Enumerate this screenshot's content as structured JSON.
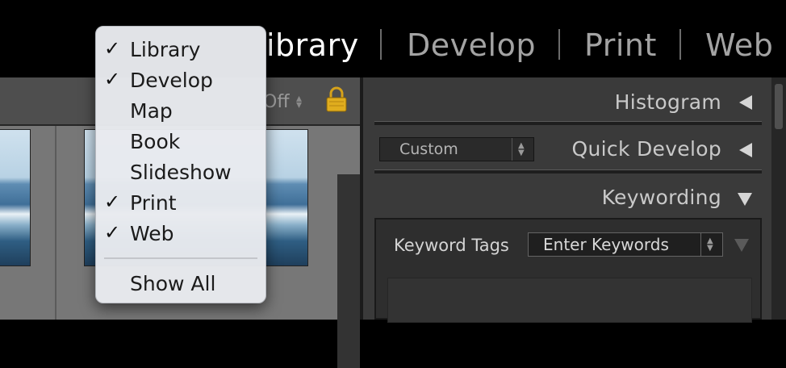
{
  "module_bar": {
    "partial_active": "ibrary",
    "items": [
      "Develop",
      "Print",
      "Web"
    ]
  },
  "toolbar": {
    "sort_value": "Off"
  },
  "right_panel": {
    "histogram": "Histogram",
    "quick_develop": "Quick Develop",
    "preset_value": "Custom",
    "keywording": "Keywording",
    "keyword_tags_label": "Keyword Tags",
    "keyword_select_value": "Enter Keywords"
  },
  "menu": {
    "items": [
      {
        "label": "Library",
        "checked": true,
        "check": "✓"
      },
      {
        "label": "Develop",
        "checked": true,
        "check": "✓"
      },
      {
        "label": "Map",
        "checked": false,
        "check": ""
      },
      {
        "label": "Book",
        "checked": false,
        "check": ""
      },
      {
        "label": "Slideshow",
        "checked": false,
        "check": ""
      },
      {
        "label": "Print",
        "checked": true,
        "check": "✓"
      },
      {
        "label": "Web",
        "checked": true,
        "check": "✓"
      }
    ],
    "show_all": "Show All"
  },
  "icons": {
    "lock": "lock-icon",
    "stepper": "stepper-icon",
    "collapse": "triangle-left-icon",
    "expand": "triangle-down-icon"
  },
  "colors": {
    "menu_bg": "#e8eaee",
    "panel_bg": "#3a3a3a",
    "module_active": "#ffffff",
    "module_dim": "#a3a3a3"
  }
}
